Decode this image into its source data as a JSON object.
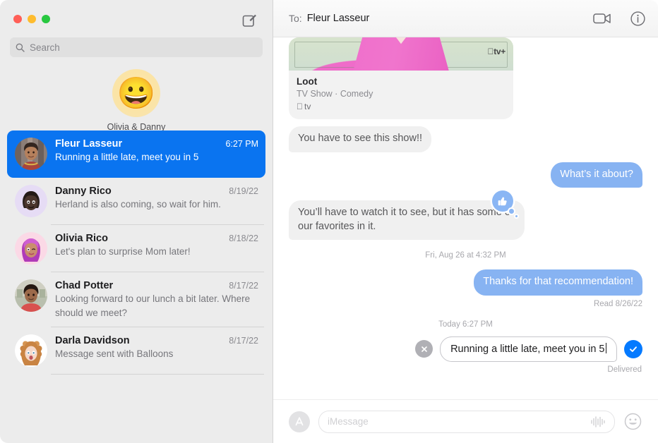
{
  "window": {
    "traffic_lights": [
      "close",
      "minimize",
      "maximize"
    ],
    "compose_icon": "compose-pencil-icon"
  },
  "sidebar": {
    "search": {
      "placeholder": "Search",
      "icon": "search-icon"
    },
    "pinned": [
      {
        "name": "Olivia & Danny",
        "avatar_emoji": "😀",
        "avatar_type": "emoji"
      }
    ],
    "conversations": [
      {
        "name": "Fleur Lasseur",
        "date": "6:27 PM",
        "preview": "Running a little late, meet you in 5",
        "selected": true,
        "avatar_type": "photo"
      },
      {
        "name": "Danny Rico",
        "date": "8/19/22",
        "preview": "Herland is also coming, so wait for him.",
        "selected": false,
        "avatar_type": "memoji"
      },
      {
        "name": "Olivia Rico",
        "date": "8/18/22",
        "preview": "Let's plan to surprise Mom later!",
        "selected": false,
        "avatar_type": "memoji"
      },
      {
        "name": "Chad Potter",
        "date": "8/17/22",
        "preview": "Looking forward to our lunch a bit later. Where should we meet?",
        "selected": false,
        "avatar_type": "photo"
      },
      {
        "name": "Darla Davidson",
        "date": "8/17/22",
        "preview": "Message sent with Balloons",
        "selected": false,
        "avatar_type": "memoji"
      }
    ]
  },
  "chat": {
    "header": {
      "to_label": "To:",
      "recipient": "Fleur Lasseur",
      "facetime_icon": "video-camera-icon",
      "info_icon": "info-circle-icon"
    },
    "link_preview": {
      "title": "Loot",
      "subtitle": "TV Show · Comedy",
      "app_name": "tv",
      "watermark": "tv+"
    },
    "messages": [
      {
        "id": "m1",
        "direction": "incoming",
        "text": "You have to see this show!!"
      },
      {
        "id": "m2",
        "direction": "outgoing",
        "text": "What’s it about?"
      },
      {
        "id": "m3",
        "direction": "incoming",
        "text": "You’ll have to watch it to see, but it has some of our favorites in it.",
        "tapback": "thumbs-up"
      }
    ],
    "timestamp_1": "Fri, Aug 26 at 4:32 PM",
    "message_4": {
      "direction": "outgoing",
      "text": "Thanks for that recommendation!"
    },
    "read_receipt": "Read 8/26/22",
    "timestamp_2": "Today 6:27 PM",
    "edit": {
      "draft_text": "Running a little late, meet you in 5",
      "cancel_icon": "close-x-icon",
      "confirm_icon": "checkmark-icon",
      "status": "Delivered"
    },
    "compose": {
      "apps_icon": "app-store-icon",
      "placeholder": "iMessage",
      "audio_icon": "audio-waveform-icon",
      "emoji_icon": "smiley-face-icon"
    }
  },
  "colors": {
    "accent_blue": "#0a74f0",
    "outgoing_bubble": "#87b3f2",
    "incoming_bubble": "#f0f0f0",
    "confirm_blue": "#057aff",
    "sidebar_bg": "#ececec"
  }
}
